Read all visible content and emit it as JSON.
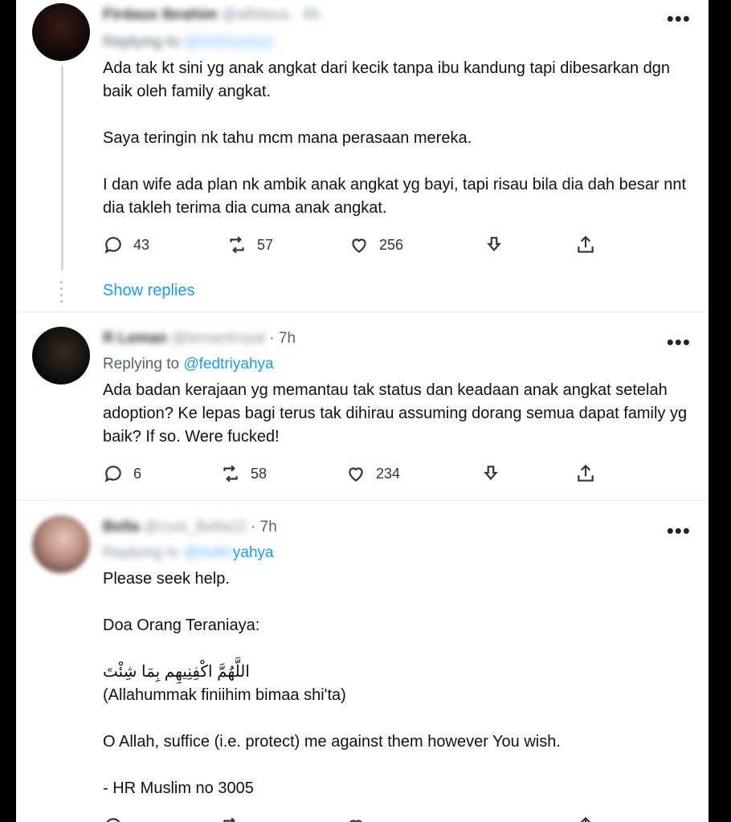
{
  "tweets": [
    {
      "author_name": "Firdaus Ibrahim",
      "author_handle": "@alfidaus",
      "time": "· 6h",
      "replying_prefix": "Replying to",
      "replying_handle": "@fedtriyahya",
      "text": "Ada tak kt sini yg anak angkat dari kecik tanpa ibu kandung tapi dibesarkan dgn baik oleh family angkat.\n\nSaya teringin nk tahu mcm mana perasaan mereka.\n\nI dan wife ada plan nk ambik anak angkat yg bayi, tapi risau bila dia dah besar nnt dia takleh terima dia cuma anak angkat.",
      "replies": "43",
      "retweets": "57",
      "likes": "256",
      "show_replies": "Show replies"
    },
    {
      "author_name": "R Leman",
      "author_handle": "@lemanlroyal",
      "time": "· 7h",
      "replying_prefix": "Replying to",
      "replying_handle": "@fedtriyahya",
      "text": "Ada badan kerajaan yg memantau tak status dan keadaan anak angkat setelah adoption? Ke lepas bagi terus tak dihirau assuming dorang semua dapat family yg baik? If so. Were fucked!",
      "replies": "6",
      "retweets": "58",
      "likes": "234"
    },
    {
      "author_name": "Bella",
      "author_handle": "@cust_Bella22",
      "time": "· 7h",
      "replying_prefix": "Replying to",
      "replying_handle_blurred": "@fedtri",
      "replying_handle_visible": "yahya",
      "text": "Please seek help.\n\nDoa Orang Teraniaya:\n\nاللَّهُمَّ اكْفِنِيهِم بِمَا شِئْتَ\n(Allahummak finiihim bimaa shi'ta)\n\nO Allah, suffice (i.e. protect) me against them however You wish.\n\n- HR Muslim no 3005"
    }
  ],
  "icons": {
    "more": "more-horizontal-icon",
    "reply": "comment-icon",
    "retweet": "retweet-icon",
    "like": "heart-icon",
    "react": "download-arrow-icon",
    "share": "share-icon"
  },
  "colors": {
    "accent": "#1d9bf0",
    "muted": "#536471",
    "divider": "#e6ecf0"
  }
}
